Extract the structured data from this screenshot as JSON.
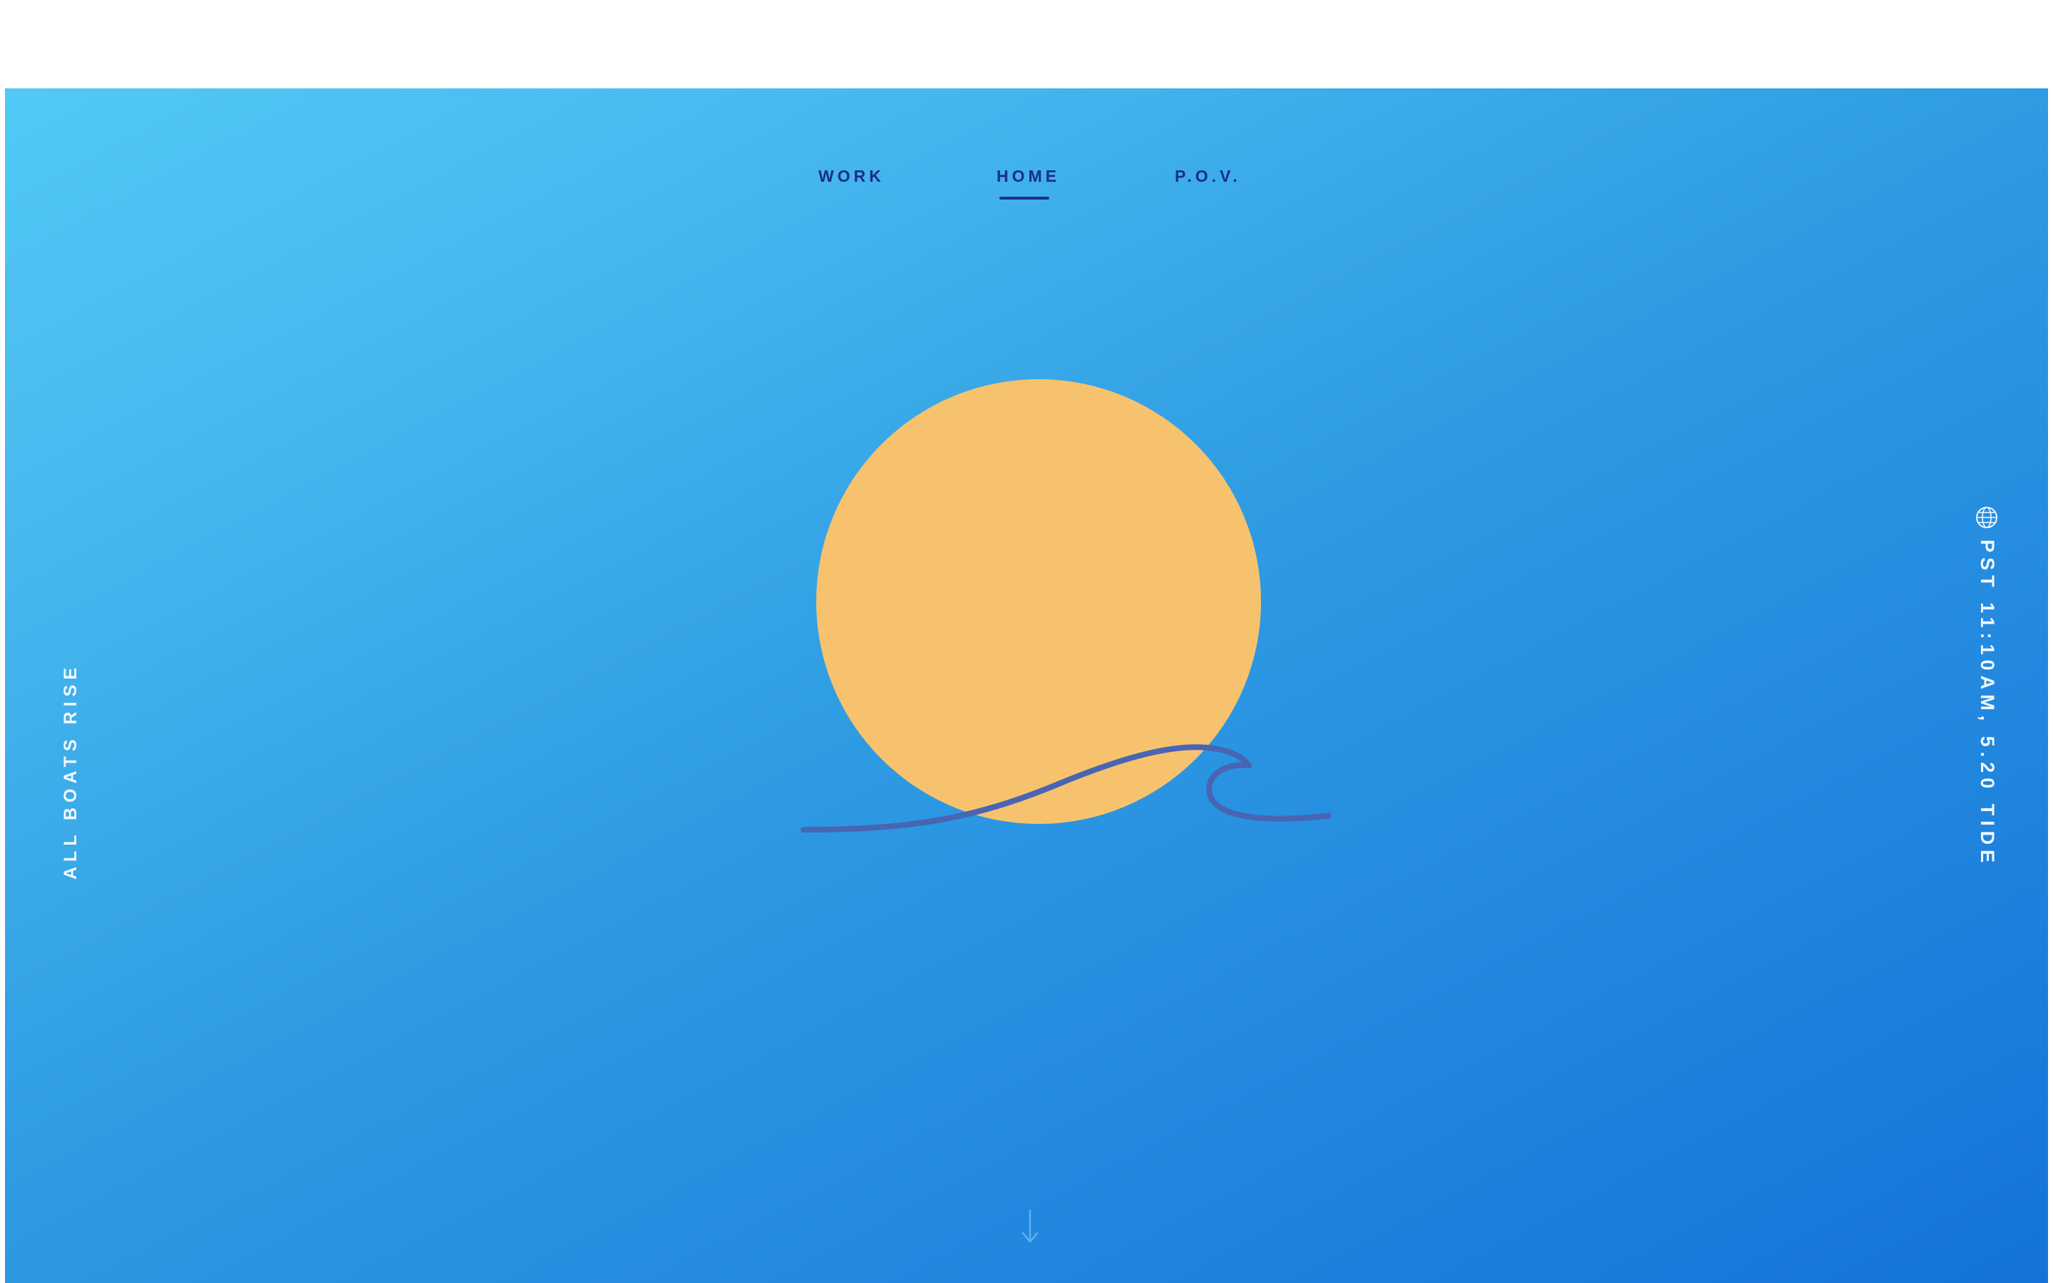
{
  "nav": {
    "items": [
      {
        "label": "WORK",
        "active": false
      },
      {
        "label": "HOME",
        "active": true
      },
      {
        "label": "P.O.V.",
        "active": false
      }
    ]
  },
  "side": {
    "left_text": "ALL BOATS RISE",
    "right_text": "PST 11:10AM, 5.20 TIDE",
    "right_icon": "globe-icon"
  },
  "logo": {
    "icon": "sun-wave-logo"
  },
  "scroll": {
    "icon": "arrow-down-icon"
  },
  "colors": {
    "background_start": "#52c9f5",
    "background_end": "#1373d8",
    "sun": "#f7c26e",
    "wave": "#4865b4",
    "nav_text": "#1b2c8c",
    "side_text": "#f2f8ff"
  }
}
